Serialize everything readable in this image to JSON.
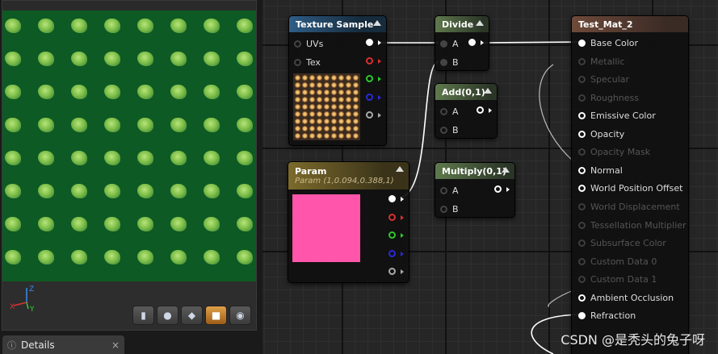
{
  "details_tab": {
    "label": "Details",
    "close": "×"
  },
  "viewport": {
    "axis_z": "Z",
    "axis_y": "Y",
    "axis_x": "X",
    "buttons": [
      {
        "icon": "cylinder-icon",
        "glyph": "▮"
      },
      {
        "icon": "sphere-icon",
        "glyph": "●"
      },
      {
        "icon": "plane-icon",
        "glyph": "◆"
      },
      {
        "icon": "cube-icon",
        "glyph": "■"
      },
      {
        "icon": "teapot-icon",
        "glyph": "◉"
      }
    ],
    "active_button": 3
  },
  "nodes": {
    "texture_sample": {
      "title": "Texture Sample",
      "inputs": [
        "UVs",
        "Tex"
      ]
    },
    "divide": {
      "title": "Divide",
      "inputs": [
        "A",
        "B"
      ]
    },
    "add": {
      "title": "Add(0,1)",
      "inputs": [
        "A",
        "B"
      ]
    },
    "multiply": {
      "title": "Multiply(0,1)",
      "inputs": [
        "A",
        "B"
      ]
    },
    "param": {
      "title": "Param",
      "subtitle": "Param (1,0.094,0.388,1)",
      "color": "#ff55aa"
    },
    "material": {
      "title": "Test_Mat_2",
      "pins": [
        {
          "label": "Base Color",
          "enabled": true,
          "connected": true
        },
        {
          "label": "Metallic",
          "enabled": false
        },
        {
          "label": "Specular",
          "enabled": false
        },
        {
          "label": "Roughness",
          "enabled": false
        },
        {
          "label": "Emissive Color",
          "enabled": true
        },
        {
          "label": "Opacity",
          "enabled": true
        },
        {
          "label": "Opacity Mask",
          "enabled": false
        },
        {
          "label": "Normal",
          "enabled": true
        },
        {
          "label": "World Position Offset",
          "enabled": true
        },
        {
          "label": "World Displacement",
          "enabled": false
        },
        {
          "label": "Tessellation Multiplier",
          "enabled": false
        },
        {
          "label": "Subsurface Color",
          "enabled": false
        },
        {
          "label": "Custom Data 0",
          "enabled": false
        },
        {
          "label": "Custom Data 1",
          "enabled": false
        },
        {
          "label": "Ambient Occlusion",
          "enabled": true
        },
        {
          "label": "Refraction",
          "enabled": true,
          "connected": true
        }
      ]
    }
  },
  "watermark": "CSDN @是秃头的兔子呀"
}
